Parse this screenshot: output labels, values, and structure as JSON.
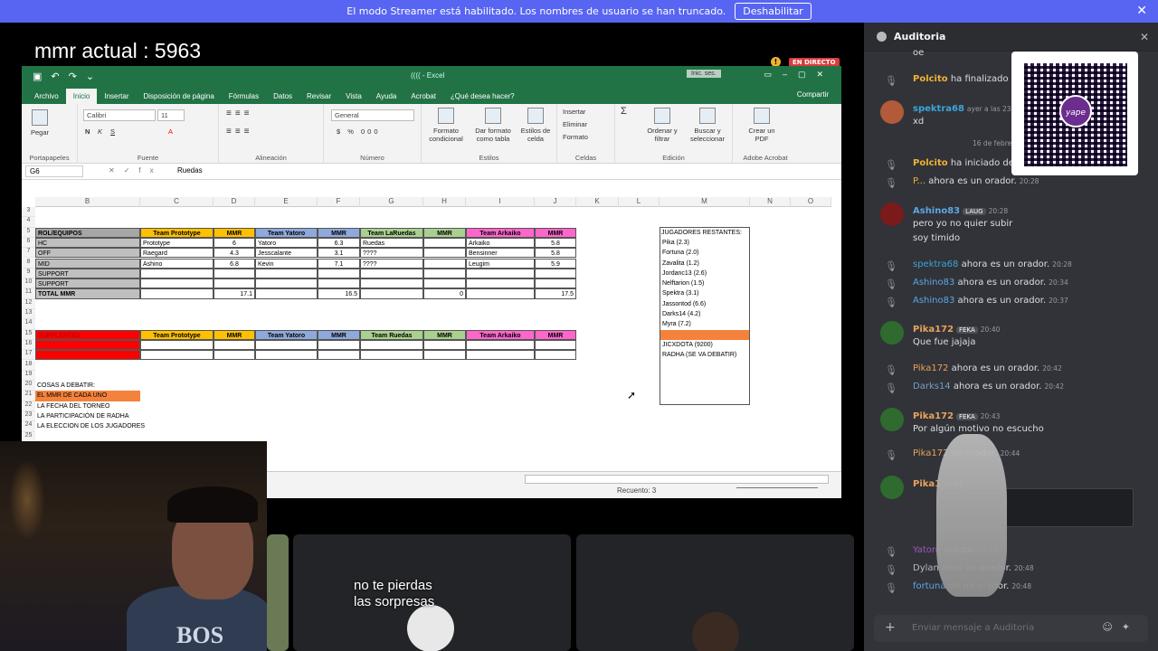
{
  "banner": {
    "text": "El modo Streamer está habilitado. Los nombres de usuario se han truncado.",
    "button": "Deshabilitar"
  },
  "overlay": {
    "mmr": "mmr actual : 5963",
    "live": "EN DIRECTO",
    "caption": "no te pierdas las sorpresas"
  },
  "excel": {
    "filename": "(((( - Excel",
    "signin": "Inic. ses.",
    "tabs": [
      "Archivo",
      "Inicio",
      "Insertar",
      "Disposición de página",
      "Fórmulas",
      "Datos",
      "Revisar",
      "Vista",
      "Ayuda",
      "Acrobat",
      "¿Qué desea hacer?"
    ],
    "share": "Compartir",
    "ribbon": {
      "paste": "Pegar",
      "font_name": "Calibri",
      "font_size": "11",
      "number_format": "General",
      "insert": "Insertar",
      "delete": "Eliminar",
      "format": "Formato",
      "conditional": "Formato condicional",
      "as_table": "Dar formato como tabla",
      "cell_styles": "Estilos de celda",
      "sort": "Ordenar y filtrar",
      "find": "Buscar y seleccionar",
      "pdf": "Crear un PDF",
      "groups": [
        "Portapapeles",
        "Fuente",
        "Alineación",
        "Número",
        "Estilos",
        "Celdas",
        "Edición",
        "Adobe Acrobat"
      ]
    },
    "namebox": "G6",
    "formula": "Ruedas",
    "columns": [
      "B",
      "C",
      "D",
      "E",
      "F",
      "G",
      "H",
      "I",
      "J",
      "K",
      "L",
      "M",
      "N",
      "O"
    ],
    "rows": [
      "3",
      "4",
      "5",
      "6",
      "7",
      "8",
      "9",
      "10",
      "11",
      "12",
      "13",
      "14",
      "15",
      "16",
      "17",
      "18",
      "19",
      "20",
      "21",
      "22",
      "23",
      "24",
      "25",
      "26"
    ],
    "table1": {
      "headers": [
        "ROL/EQUIPOS",
        "Team Prototype",
        "MMR",
        "Team Yatoro",
        "MMR",
        "Team LaRuedas",
        "MMR",
        "Team Arkaiko",
        "MMR"
      ],
      "rows": [
        [
          "HC",
          "Prototype",
          "6",
          "Yatoro",
          "6.3",
          "Ruedas",
          "",
          "Arkaiko",
          "5.8"
        ],
        [
          "OFF",
          "Raegard",
          "4.3",
          "Jesscalante",
          "3.1",
          "????",
          "",
          "Bensinner",
          "5.8"
        ],
        [
          "MID",
          "Ashino",
          "6.8",
          "Kevin",
          "7.1",
          "????",
          "",
          "Leugim",
          "5.9"
        ],
        [
          "SUPPORT",
          "",
          "",
          "",
          "",
          "",
          "",
          "",
          ""
        ],
        [
          "SUPPORT",
          "",
          "",
          "",
          "",
          "",
          "",
          "",
          ""
        ]
      ],
      "total": [
        "TOTAL MMR",
        "",
        "17.1",
        "",
        "16.5",
        "",
        "0",
        "",
        "17.5"
      ]
    },
    "table2": {
      "headers": [
        "SUPPLENTES",
        "Team Prototype",
        "MMR",
        "Team Yatoro",
        "MMR",
        "Team Ruedas",
        "MMR",
        "Team Arkaiko",
        "MMR"
      ]
    },
    "debate": [
      "COSAS A DEBATIR:",
      "EL MMR DE CADA UNO",
      "LA FECHA DEL TORNEO",
      "LA PARTICIPACIÓN DE RADHA",
      "LA ELECCION DE LOS JUGADORES"
    ],
    "remaining": {
      "title": "JUGADORES RESTANTES:",
      "players": [
        "Pika (2.3)",
        "Fortuna (2.0)",
        "Zavalita (1.2)",
        "Jordanc13 (2.6)",
        "Nelftarion (1.5)",
        "Spektra (3.1)",
        "Jassontod (6.6)",
        "Darks14 (4.2)",
        "Myra (7.2)",
        "",
        "JICXDOTA (9200)",
        "RADHA (SE VA DEBATIR)"
      ]
    },
    "status_count": "Recuento: 3"
  },
  "chat": {
    "title": "Auditoria",
    "date_sep": "16 de febrero",
    "messages": [
      {
        "kind": "text",
        "text": "oe"
      },
      {
        "kind": "event",
        "name": "Polcito",
        "name_color": "#f0b232",
        "text": "ha finalizado el t"
      },
      {
        "kind": "msg",
        "name": "spektra68",
        "name_color": "#3ba5d9",
        "time": "ayer a las 23:35",
        "text": "xd"
      },
      {
        "kind": "event",
        "name": "Polcito",
        "name_color": "#f0b232",
        "text": "ha iniciado deba"
      },
      {
        "kind": "event",
        "name": "P...",
        "name_color": "#f0b232",
        "text": "ahora es un orador.",
        "time": "20:28"
      },
      {
        "kind": "msg",
        "name": "Ashino83",
        "name_color": "#5ba7e8",
        "tag": "LAUG",
        "time": "20:28",
        "text": "pero yo no quier subir",
        "text2": "soy timido"
      },
      {
        "kind": "event",
        "name": "spektra68",
        "name_color": "#3ba5d9",
        "text": "ahora es un orador.",
        "time": "20:28"
      },
      {
        "kind": "event",
        "name": "Ashino83",
        "name_color": "#5ba7e8",
        "text": "ahora es un orador.",
        "time": "20:34"
      },
      {
        "kind": "event",
        "name": "Ashino83",
        "name_color": "#5ba7e8",
        "text": "ahora es un orador.",
        "time": "20:37"
      },
      {
        "kind": "msg",
        "name": "Pika172",
        "name_color": "#e8a35b",
        "tag": "FEKA",
        "time": "20:40",
        "text": "Que fue jajaja"
      },
      {
        "kind": "event",
        "name": "Pika172",
        "name_color": "#e8a35b",
        "text": "ahora es un orador.",
        "time": "20:42"
      },
      {
        "kind": "event",
        "name": "Darks14",
        "name_color": "#7a9cc6",
        "text": "ahora es un orador.",
        "time": "20:42"
      },
      {
        "kind": "msg",
        "name": "Pika172",
        "name_color": "#e8a35b",
        "tag": "FEKA",
        "time": "20:43",
        "text": "Por algún motivo no escucho"
      },
      {
        "kind": "event",
        "name": "Pika172",
        "name_color": "#e8a35b",
        "text": "un orador.",
        "time": "20:44"
      },
      {
        "kind": "msg",
        "name": "Pika1",
        "name_color": "#e8a35b",
        "time": "20:46",
        "text": ""
      },
      {
        "kind": "event",
        "name": "Yatoro",
        "name_color": "#9b59b6",
        "text": "orador.",
        "time": "20:47"
      },
      {
        "kind": "event",
        "name": "Dylan",
        "name_color": "#b5bac1",
        "text": "ahor un orador.",
        "time": "20:48"
      },
      {
        "kind": "event",
        "name": "fortuna",
        "name_color": "#5ba7e8",
        "text": "ah un orador.",
        "time": "20:48"
      }
    ],
    "input_placeholder": "Enviar mensaje a Auditoria",
    "qr_brand": "yape"
  },
  "colors": {
    "discord_blurple": "#5865f2",
    "excel_green": "#217346",
    "chat_bg": "#313338"
  }
}
